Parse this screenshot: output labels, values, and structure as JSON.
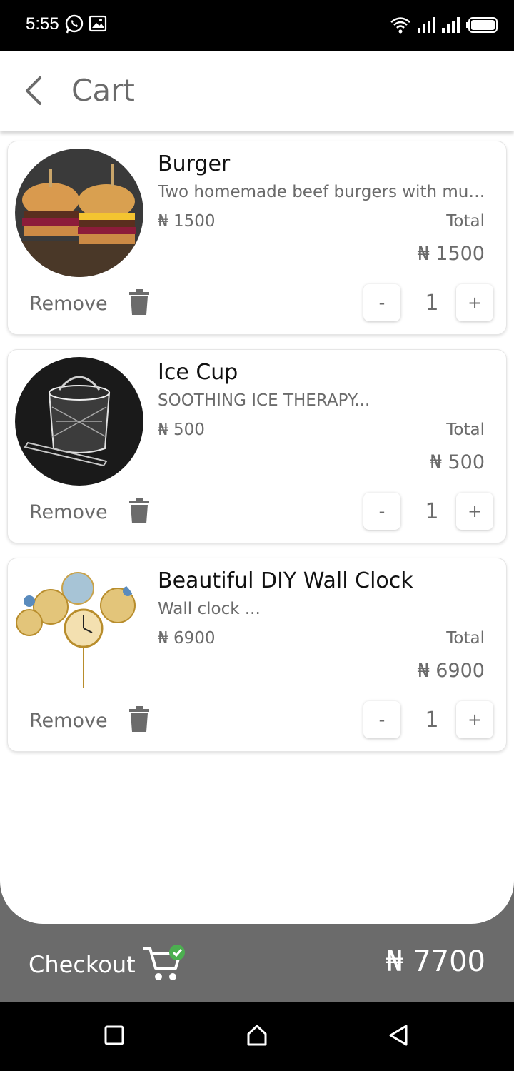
{
  "status_bar": {
    "time": "5:55",
    "icons_left": [
      "whatsapp-icon",
      "gallery-icon"
    ],
    "icons_right": [
      "wifi-icon",
      "signal-icon",
      "signal-icon",
      "battery-icon"
    ]
  },
  "header": {
    "title": "Cart",
    "back_icon": "chevron-left-icon"
  },
  "cart_items": [
    {
      "name": "Burger",
      "description": "Two homemade beef burgers with mus...",
      "price": "₦ 1500",
      "total_label": "Total",
      "total": "₦ 1500",
      "remove_label": "Remove",
      "decrement": "-",
      "quantity": "1",
      "increment": "+"
    },
    {
      "name": "Ice Cup",
      "description": "SOOTHING ICE THERAPY...",
      "price": "₦ 500",
      "total_label": "Total",
      "total": "₦ 500",
      "remove_label": "Remove",
      "decrement": "-",
      "quantity": "1",
      "increment": "+"
    },
    {
      "name": "Beautiful DIY Wall Clock",
      "description": "Wall clock ...",
      "price": "₦ 6900",
      "total_label": "Total",
      "total": "₦ 6900",
      "remove_label": "Remove",
      "decrement": "-",
      "quantity": "1",
      "increment": "+"
    }
  ],
  "checkout": {
    "label": "Checkout",
    "icon": "cart-check-icon",
    "grand_total": "₦ 7700"
  },
  "colors": {
    "primary_gray": "#6b6b6b",
    "check_green": "#4caf50"
  },
  "nav_bar": {
    "buttons": [
      "recent-apps-icon",
      "home-icon",
      "back-icon"
    ]
  }
}
